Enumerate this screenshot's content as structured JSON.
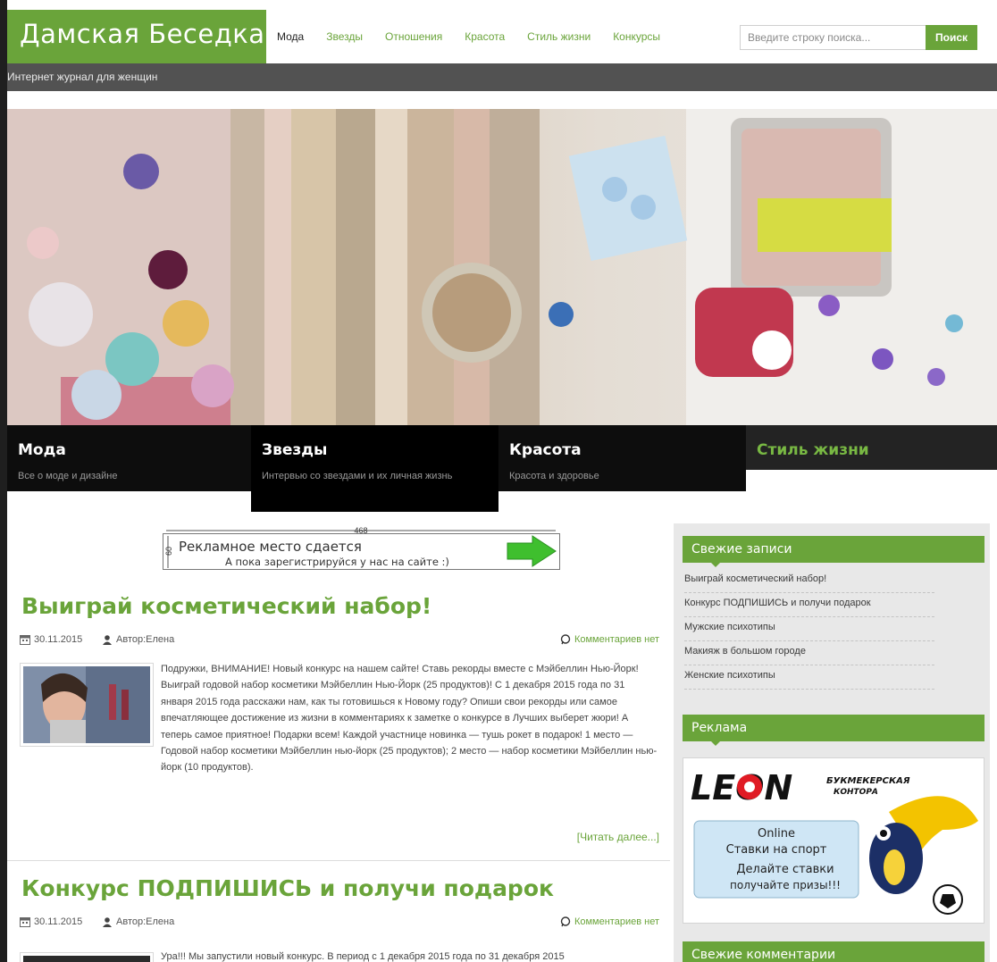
{
  "header": {
    "logo": "Дамская Беседка",
    "tagline": "Интернет журнал для женщин",
    "nav": [
      {
        "label": "Мода",
        "active": true
      },
      {
        "label": "Звезды",
        "active": false
      },
      {
        "label": "Отношения",
        "active": false
      },
      {
        "label": "Красота",
        "active": false
      },
      {
        "label": "Стиль жизни",
        "active": false
      },
      {
        "label": "Конкурсы",
        "active": false
      }
    ],
    "search": {
      "placeholder": "Введите строку поиска...",
      "button": "Поиск"
    }
  },
  "categories": [
    {
      "title": "Мода",
      "desc": "Все о моде и дизайне"
    },
    {
      "title": "Звезды",
      "desc": "Интервью со звездами и их личная жизнь"
    },
    {
      "title": "Красота",
      "desc": "Красота и здоровье"
    },
    {
      "title": "Стиль жизни",
      "desc": ""
    }
  ],
  "ad_banner": {
    "size_label": "468",
    "height_label": "60",
    "line1": "Рекламное место сдается",
    "line2": "А пока зарегистрируйся у нас на сайте :)"
  },
  "posts": [
    {
      "title": "Выиграй косметический набор!",
      "date": "30.11.2015",
      "author": "Автор:Елена",
      "comments": "Комментариев нет",
      "excerpt": "Подружки, ВНИМАНИЕ! Новый конкурс на нашем сайте! Ставь рекорды вместе с Мэйбеллин Нью-Йорк! Выиграй годовой набор косметики Мэйбеллин Нью-Йорк (25 продуктов)! С 1 декабря 2015 года по 31 января 2015 года расскажи нам, как ты готовишься к Новому году? Опиши свои рекорды или самое впечатляющее достижение из жизни в комментариях к заметке о конкурсе в Лучших выберет жюри! А теперь самое приятное! Подарки всем! Каждой участнице новинка — тушь рокет в подарок! 1 место — Годовой набор косметики Мэйбеллин нью-йорк (25 продуктов); 2 место — набор косметики Мэйбеллин нью-йорк (10 продуктов).",
      "read_more": "[Читать далее...]"
    },
    {
      "title": "Конкурс ПОДПИШИСЬ и получи подарок",
      "date": "30.11.2015",
      "author": "Автор:Елена",
      "comments": "Комментариев нет",
      "excerpt": "Ура!!! Мы запустили новый конкурс. В период с 1 декабря 2015 года по 31 декабря 2015"
    }
  ],
  "sidebar": {
    "recent_title": "Свежие записи",
    "recent": [
      "Выиграй косметический набор!",
      "Конкурс ПОДПИШИСЬ и получи подарок",
      "Мужские психотипы",
      "Макияж в большом городе",
      "Женские психотипы"
    ],
    "ad_title": "Реклама",
    "ad": {
      "brand": "LEON",
      "brand_sub1": "БУКМЕКЕРСКАЯ",
      "brand_sub2": "КОНТОРА",
      "line1": "Online",
      "line2": "Ставки на спорт",
      "line3": "Делайте ставки",
      "line4": "получайте призы!!!"
    },
    "comments_title": "Свежие комментарии"
  },
  "colors": {
    "accent": "#6aa43a",
    "dark": "#0d0d0d",
    "subbar": "#525252"
  }
}
